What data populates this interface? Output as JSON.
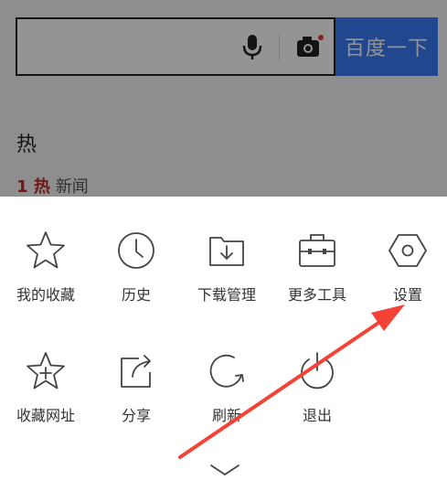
{
  "search": {
    "placeholder": "",
    "button_label": "百度一下"
  },
  "hot": {
    "title": "热",
    "first_item": "1",
    "first_tag": "热",
    "first_text": "新闻"
  },
  "menu": {
    "row1": [
      {
        "label": "我的收藏",
        "icon": "star-icon"
      },
      {
        "label": "历史",
        "icon": "clock-icon"
      },
      {
        "label": "下载管理",
        "icon": "download-folder-icon"
      },
      {
        "label": "更多工具",
        "icon": "toolbox-icon"
      },
      {
        "label": "设置",
        "icon": "hexagon-settings-icon"
      }
    ],
    "row2": [
      {
        "label": "收藏网址",
        "icon": "star-plus-icon"
      },
      {
        "label": "分享",
        "icon": "share-icon"
      },
      {
        "label": "刷新",
        "icon": "refresh-icon"
      },
      {
        "label": "退出",
        "icon": "power-icon"
      }
    ]
  },
  "colors": {
    "accent": "#3a7cf7",
    "annotation": "#f44336"
  }
}
